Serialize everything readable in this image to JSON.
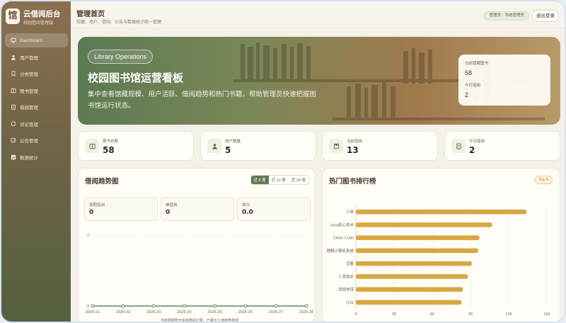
{
  "brand": {
    "logo_char": "馆",
    "title": "云借阅后台",
    "subtitle": "校园借阅管理端"
  },
  "sidebar": {
    "items": [
      {
        "label": "Dashboard",
        "icon": "monitor-icon",
        "active": true
      },
      {
        "label": "用户管理",
        "icon": "user-icon"
      },
      {
        "label": "分类管理",
        "icon": "bookmark-icon"
      },
      {
        "label": "图书管理",
        "icon": "book-icon"
      },
      {
        "label": "借阅管理",
        "icon": "clipboard-icon"
      },
      {
        "label": "评论管理",
        "icon": "comment-icon"
      },
      {
        "label": "公告管理",
        "icon": "edit-icon"
      },
      {
        "label": "数据统计",
        "icon": "chart-icon"
      }
    ]
  },
  "header": {
    "title": "管理首页",
    "subtitle": "馆藏、用户、借阅、公告与数据统计统一管理",
    "role_badge": "管理员：系统管理员",
    "logout_label": "退出登录"
  },
  "hero": {
    "pill": "Library Operations",
    "title": "校园图书馆运营看板",
    "description": "集中查看馆藏规模、用户活跃、借阅趋势和热门书籍，帮助管理员快速把握图书馆运行状态。",
    "card": {
      "label1": "当前馆藏图书",
      "value1": "58",
      "label2": "今日借阅",
      "value2": "2"
    }
  },
  "stats": [
    {
      "label": "图书总数",
      "value": "58",
      "icon": "book-icon"
    },
    {
      "label": "用户数量",
      "value": "5",
      "icon": "user-icon"
    },
    {
      "label": "当前借阅",
      "value": "13",
      "icon": "save-icon"
    },
    {
      "label": "今日借阅",
      "value": "2",
      "icon": "document-icon"
    }
  ],
  "trend_panel": {
    "title": "借阅趋势图",
    "tabs": [
      "近 8 周",
      "近 12 周",
      "近 24 周"
    ],
    "active_tab": 0,
    "metrics": [
      {
        "label": "周期借阅",
        "value": "0"
      },
      {
        "label": "峰值周",
        "value": "0"
      },
      {
        "label": "周均",
        "value": "0.0"
      }
    ],
    "footnote": "当前周期暂无实际借阅记录，已展示 0 值趋势基线"
  },
  "rank_panel": {
    "title": "热门图书排行榜",
    "badge": "Top 8"
  },
  "chart_data": [
    {
      "type": "line",
      "x": [
        "2026-21",
        "2026-22",
        "2026-23",
        "2026-24",
        "2026-25",
        "2026-26",
        "2026-27",
        "2026-28"
      ],
      "series": [
        {
          "values": [
            0,
            0,
            0,
            0,
            0,
            0,
            0,
            0
          ]
        }
      ],
      "ylim": [
        0,
        1
      ],
      "yticks": [
        "0",
        "1"
      ],
      "color": "#5f8a5a"
    },
    {
      "type": "bar",
      "orientation": "horizontal",
      "categories": [
        "三体",
        "Java核心技术",
        "Clean Code",
        "理解计算机系统",
        "活着",
        "人类简史",
        "流浪地球",
        "沙丘"
      ],
      "values": [
        134,
        107,
        97,
        96,
        91,
        88,
        84,
        83
      ],
      "xlim": [
        0,
        150
      ],
      "xticks": [
        "0",
        "30",
        "60",
        "90",
        "120",
        "150"
      ],
      "color": "#d9a640"
    }
  ]
}
